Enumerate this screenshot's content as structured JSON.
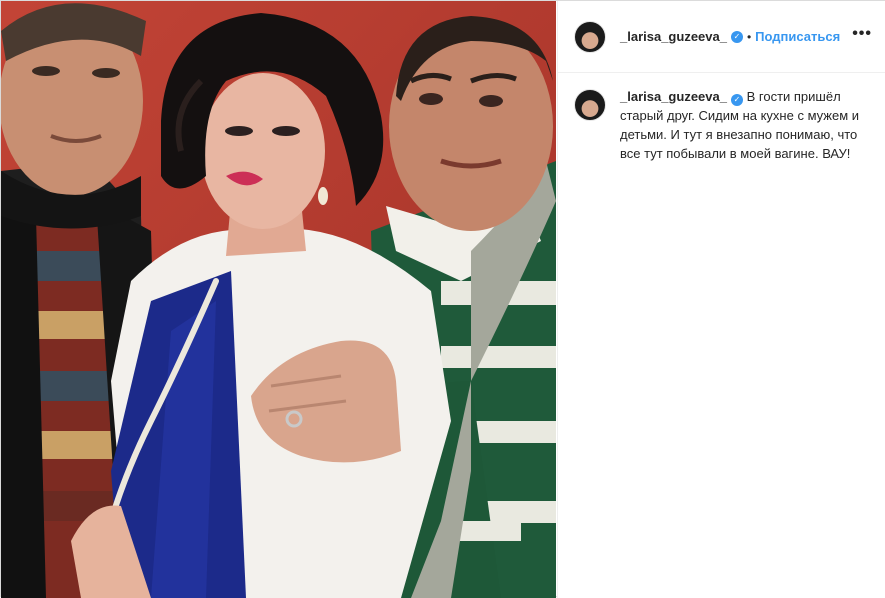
{
  "header": {
    "username": "_larisa_guzeeva_",
    "separator": "•",
    "follow_label": "Подписаться",
    "more_label": "•••"
  },
  "caption": {
    "username": "_larisa_guzeeva_",
    "text": "В гости пришёл старый друг. Сидим на кухне с мужем и детьми. И тут я внезапно понимаю, что все тут побывали в моей вагине. ВАУ!"
  },
  "icons": {
    "verified": "verified-check-icon",
    "more": "more-options-icon"
  },
  "colors": {
    "accent": "#3897f0",
    "photo_background": "#b53a2e"
  }
}
